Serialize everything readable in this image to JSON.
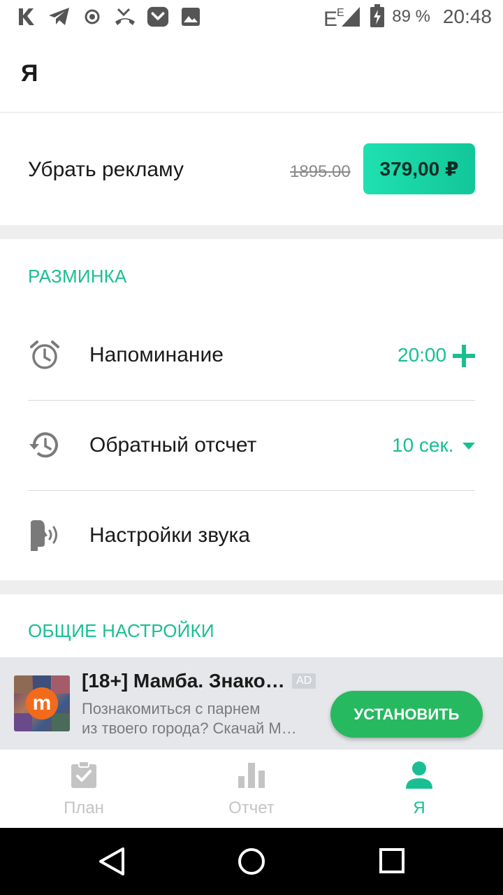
{
  "status_bar": {
    "battery": "89 %",
    "time": "20:48",
    "icons": [
      "kinopoisk-icon",
      "telegram-icon",
      "record-icon",
      "missed-call-icon",
      "pocket-icon",
      "image-icon",
      "signal-icon",
      "battery-charging-icon"
    ]
  },
  "header": {
    "title": "Я"
  },
  "remove_ads": {
    "label": "Убрать рекламу",
    "old_price": "1895.00",
    "price": "379,00 ₽"
  },
  "warmup": {
    "title": "РАЗМИНКА",
    "reminder": {
      "label": "Напоминание",
      "value": "20:00",
      "icon": "alarm-clock-icon"
    },
    "countdown": {
      "label": "Обратный отсчет",
      "value": "10 сек.",
      "icon": "history-icon"
    },
    "sound": {
      "label": "Настройки звука",
      "icon": "voice-icon"
    }
  },
  "general": {
    "title": "ОБЩИЕ НАСТРОЙКИ"
  },
  "ad": {
    "title": "[18+] Мамба. Знако…",
    "badge": "AD",
    "desc_line1": "Познакомиться с парнем",
    "desc_line2": "из твоего города? Скачай М…",
    "logo_letter": "m",
    "button": "УСТАНОВИТЬ"
  },
  "bottom_nav": {
    "items": [
      {
        "label": "План",
        "icon": "clipboard-check-icon"
      },
      {
        "label": "Отчет",
        "icon": "bar-chart-icon"
      },
      {
        "label": "Я",
        "icon": "person-icon"
      }
    ],
    "active_index": 2
  },
  "colors": {
    "accent": "#19bf93",
    "price_button": "#1fe0b0",
    "install_button": "#27b960",
    "ad_logo": "#f26b1d"
  }
}
